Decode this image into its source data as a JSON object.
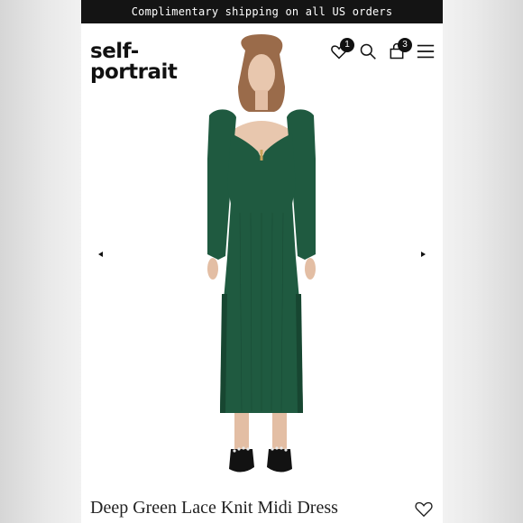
{
  "promo": {
    "text": "Complimentary shipping on all US orders"
  },
  "brand": {
    "line1": "self-",
    "line2": "portrait"
  },
  "header": {
    "wishlist_count": "1",
    "cart_count": "3",
    "icons": [
      "heart-icon",
      "search-icon",
      "bag-icon",
      "menu-icon"
    ]
  },
  "gallery": {
    "prev_icon": "caret-left-icon",
    "next_icon": "caret-right-icon"
  },
  "product": {
    "title": "Deep Green Lace Knit Midi Dress",
    "wishlist_icon": "heart-outline-icon"
  },
  "colors": {
    "dress": "#1f5a40",
    "dress_shadow": "#174631",
    "skin": "#e8c7ae",
    "hair": "#9a6b4a",
    "shoe": "#121212",
    "text": "#111111"
  }
}
